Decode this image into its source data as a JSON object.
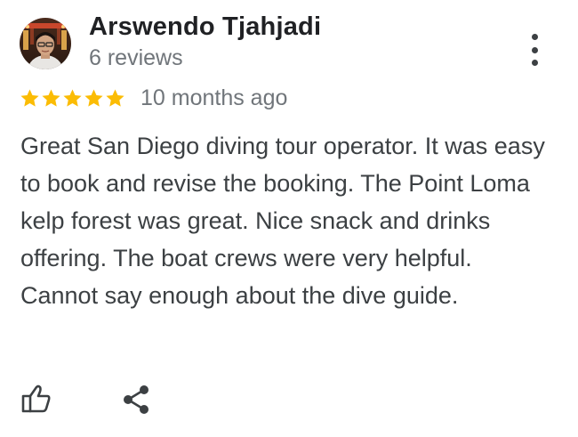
{
  "reviewer": {
    "name": "Arswendo Tjahjadi",
    "review_count": "6 reviews",
    "avatar_icon": "user-photo-avatar"
  },
  "review": {
    "rating": 5,
    "rating_max": 5,
    "date": "10 months ago",
    "text": "Great San Diego diving tour operator. It was easy to book and revise the booking. The Point Loma kelp forest was great. Nice snack and drinks offering. The boat crews were very helpful. Cannot say enough about the dive guide."
  },
  "actions": {
    "more_icon": "more-vert-icon",
    "like_icon": "thumb-up-icon",
    "share_icon": "share-icon"
  },
  "colors": {
    "star": "#FBBC04",
    "name": "#202124",
    "secondary_text": "#70757a",
    "body_text": "#3c4043",
    "icon": "#3c4043"
  }
}
